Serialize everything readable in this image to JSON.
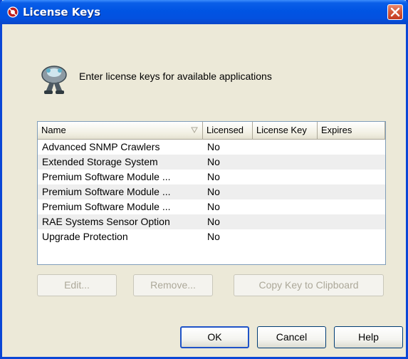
{
  "window": {
    "title": "License Keys"
  },
  "header": {
    "text": "Enter license keys for available applications",
    "icon": "plug-connector-icon"
  },
  "table": {
    "columns": [
      "Name",
      "Licensed",
      "License Key",
      "Expires"
    ],
    "rows": [
      {
        "name": "Advanced SNMP Crawlers",
        "licensed": "No",
        "key": "",
        "expires": ""
      },
      {
        "name": "Extended Storage System",
        "licensed": "No",
        "key": "",
        "expires": ""
      },
      {
        "name": "Premium Software Module ...",
        "licensed": "No",
        "key": "",
        "expires": ""
      },
      {
        "name": "Premium Software Module ...",
        "licensed": "No",
        "key": "",
        "expires": ""
      },
      {
        "name": "Premium Software Module ...",
        "licensed": "No",
        "key": "",
        "expires": ""
      },
      {
        "name": "RAE Systems Sensor Option",
        "licensed": "No",
        "key": "",
        "expires": ""
      },
      {
        "name": "Upgrade Protection",
        "licensed": "No",
        "key": "",
        "expires": ""
      }
    ]
  },
  "actions": {
    "edit": "Edit...",
    "remove": "Remove...",
    "copy": "Copy Key to Clipboard"
  },
  "footer": {
    "ok": "OK",
    "cancel": "Cancel",
    "help": "Help"
  },
  "colors": {
    "titlebar": "#0054e3",
    "dialog": "#ece9d8",
    "close": "#c33a1f"
  }
}
